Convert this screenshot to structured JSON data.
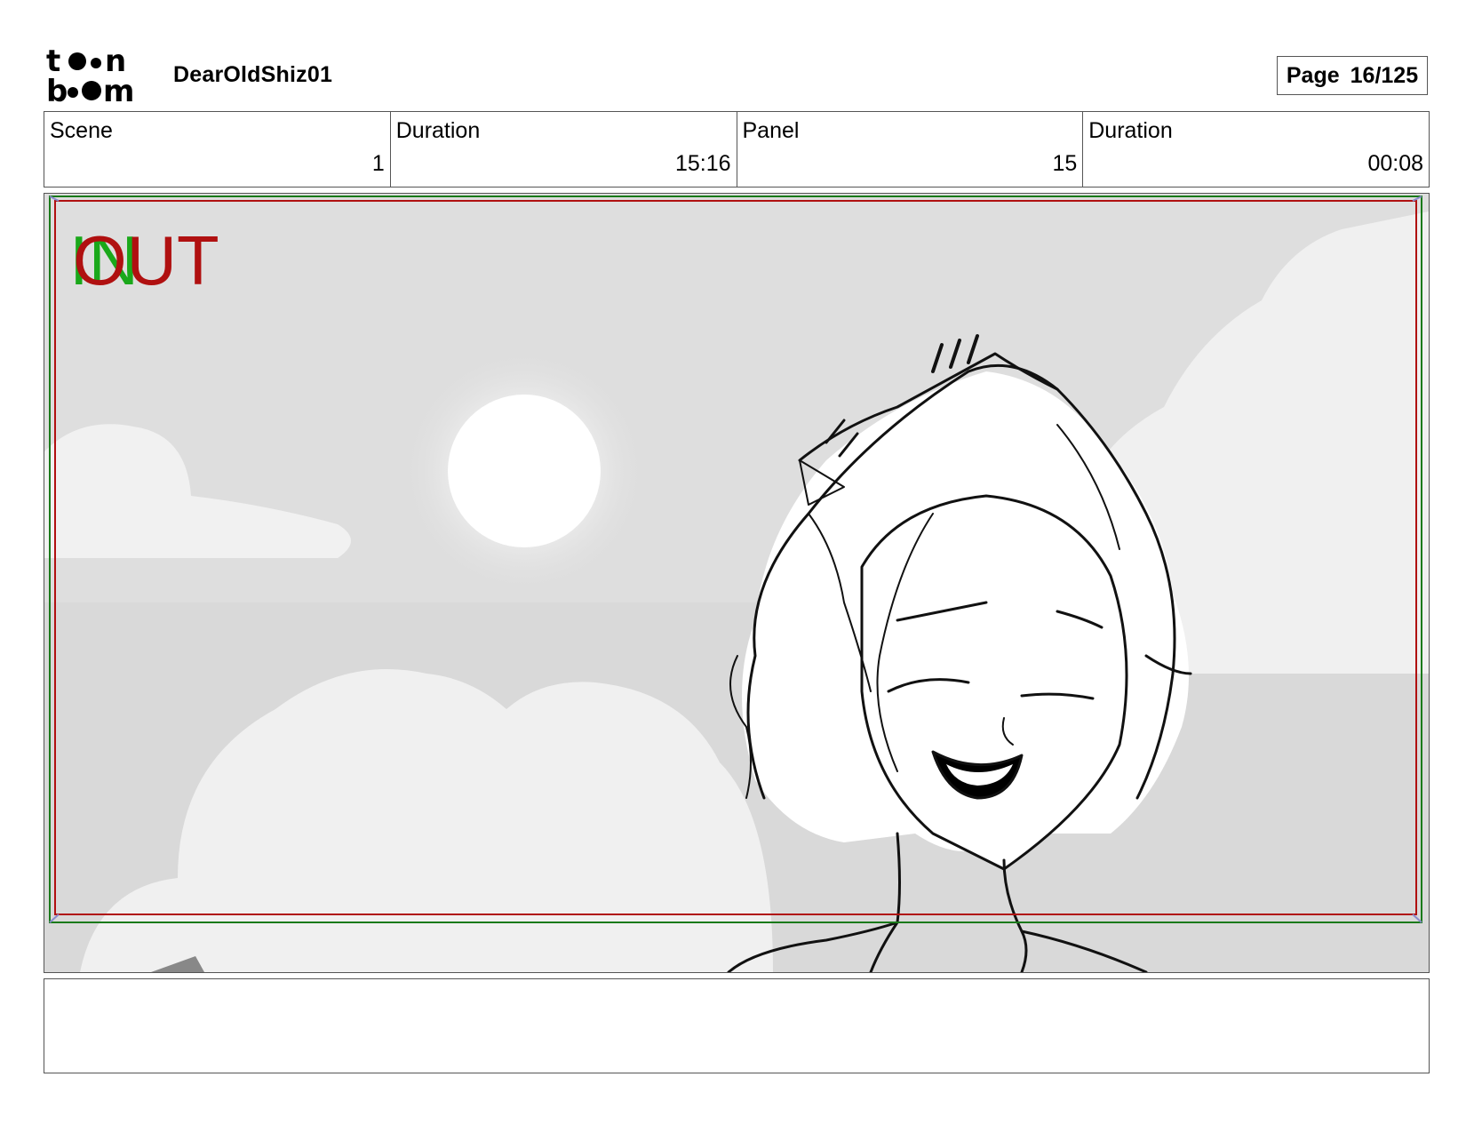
{
  "header": {
    "project_title": "DearOldShiz01",
    "page_label": "Page",
    "page_value": "16/125",
    "logo": {
      "text_top": "toon",
      "text_bottom": "boom"
    }
  },
  "info": [
    {
      "label": "Scene",
      "value": "1"
    },
    {
      "label": "Duration",
      "value": "15:16"
    },
    {
      "label": "Panel",
      "value": "15"
    },
    {
      "label": "Duration",
      "value": "00:08"
    }
  ],
  "panel": {
    "in_marker": "IN",
    "out_marker": "OUT",
    "description": "",
    "colors": {
      "in_frame": "#1aa81a",
      "out_frame": "#b01010",
      "sky": "#dcdcdc",
      "clouds": "#f1f1f1"
    }
  },
  "notes": {
    "text": ""
  }
}
